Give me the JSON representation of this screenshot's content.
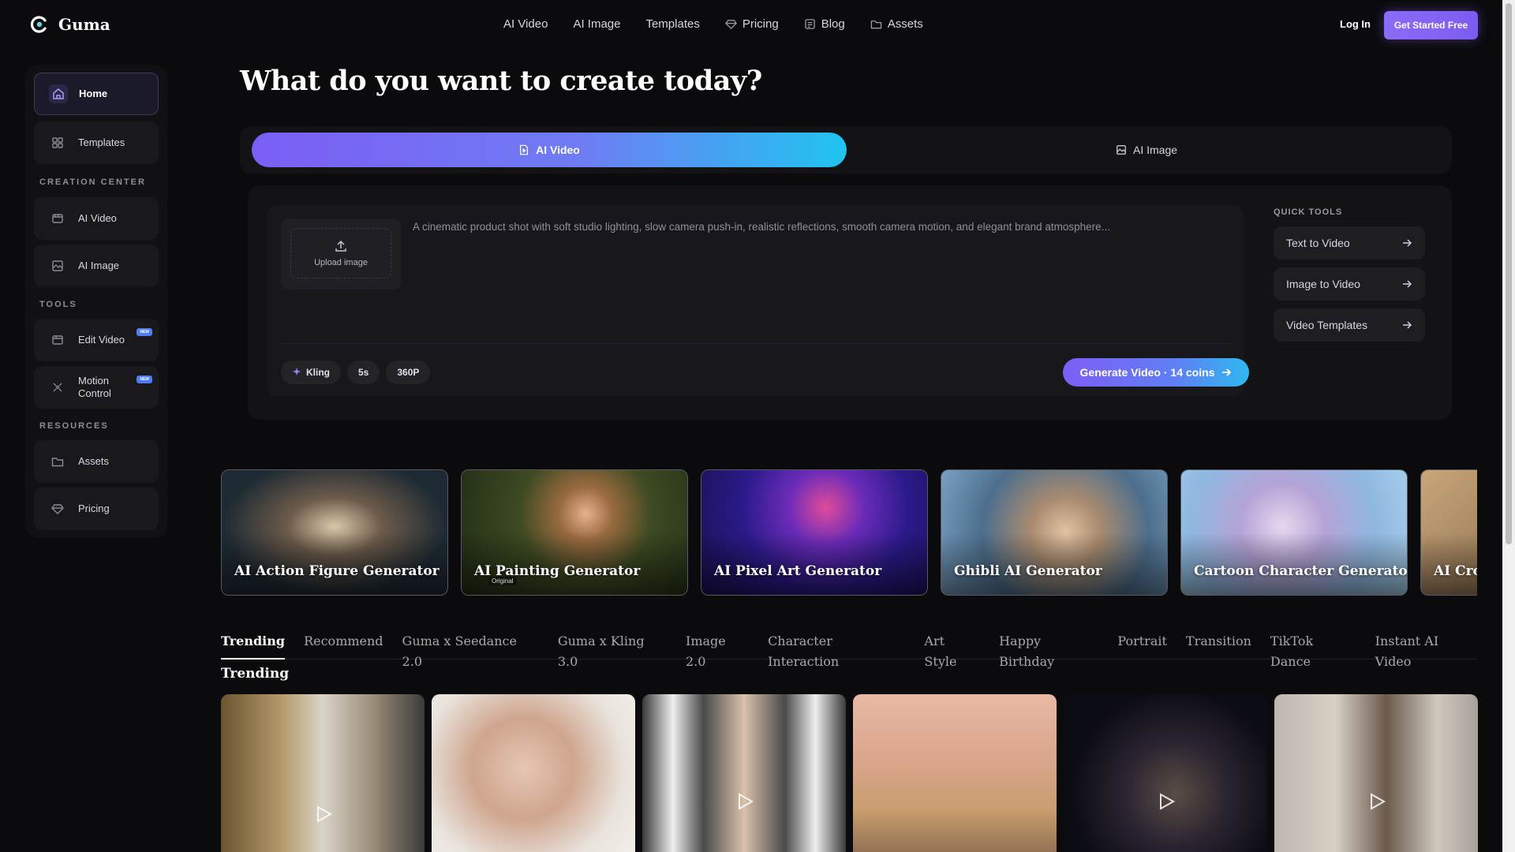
{
  "brand": {
    "name": "Guma"
  },
  "nav": {
    "items": [
      {
        "label": "AI Video",
        "icon": ""
      },
      {
        "label": "AI Image",
        "icon": ""
      },
      {
        "label": "Templates",
        "icon": ""
      },
      {
        "label": "Pricing",
        "icon": "diamond-icon"
      },
      {
        "label": "Blog",
        "icon": "blog-icon"
      },
      {
        "label": "Assets",
        "icon": "folder-icon"
      }
    ],
    "login": "Log In",
    "cta": "Get Started Free"
  },
  "sidebar": {
    "home": "Home",
    "templates": "Templates",
    "creation_center": "CREATION CENTER",
    "ai_video": "AI Video",
    "ai_image": "AI Image",
    "tools": "TOOLS",
    "edit_video": "Edit Video",
    "motion_control_1": "Motion",
    "motion_control_2": "Control",
    "new_badge": "NEW",
    "resources": "RESOURCES",
    "assets": "Assets",
    "pricing": "Pricing"
  },
  "main": {
    "title": "What do you want to create today?",
    "tabs": {
      "active": "AI Video",
      "inactive": "AI Image"
    },
    "upload": "Upload image",
    "prompt_placeholder": "A cinematic product shot with soft studio lighting, slow camera push-in, realistic reflections, smooth camera motion, and elegant brand atmosphere...",
    "chips": {
      "model": "Kling",
      "duration": "5s",
      "resolution": "360P"
    },
    "generate": "Generate Video · 14 coins",
    "quick_tools": {
      "title": "QUICK TOOLS",
      "items": [
        "Text to Video",
        "Image to Video",
        "Video Templates"
      ]
    }
  },
  "generators": [
    "AI Action Figure Generator",
    "AI Painting Generator",
    "AI Pixel Art Generator",
    "Ghibli AI Generator",
    "Cartoon Character Generator",
    "AI Cro"
  ],
  "generator_caption": "Original",
  "categories": [
    "Trending",
    "Recommend",
    "Guma x Seedance 2.0",
    "Guma x Kling 3.0",
    "Image 2.0",
    "Character Interaction",
    "Art Style",
    "Happy Birthday",
    "Portrait",
    "Transition",
    "TikTok Dance",
    "Instant AI Video"
  ],
  "section_title": "Trending",
  "colors": {
    "accent": "#7c5cf0",
    "accent_cyan": "#20c4f0",
    "bg": "#0b0b0d"
  }
}
